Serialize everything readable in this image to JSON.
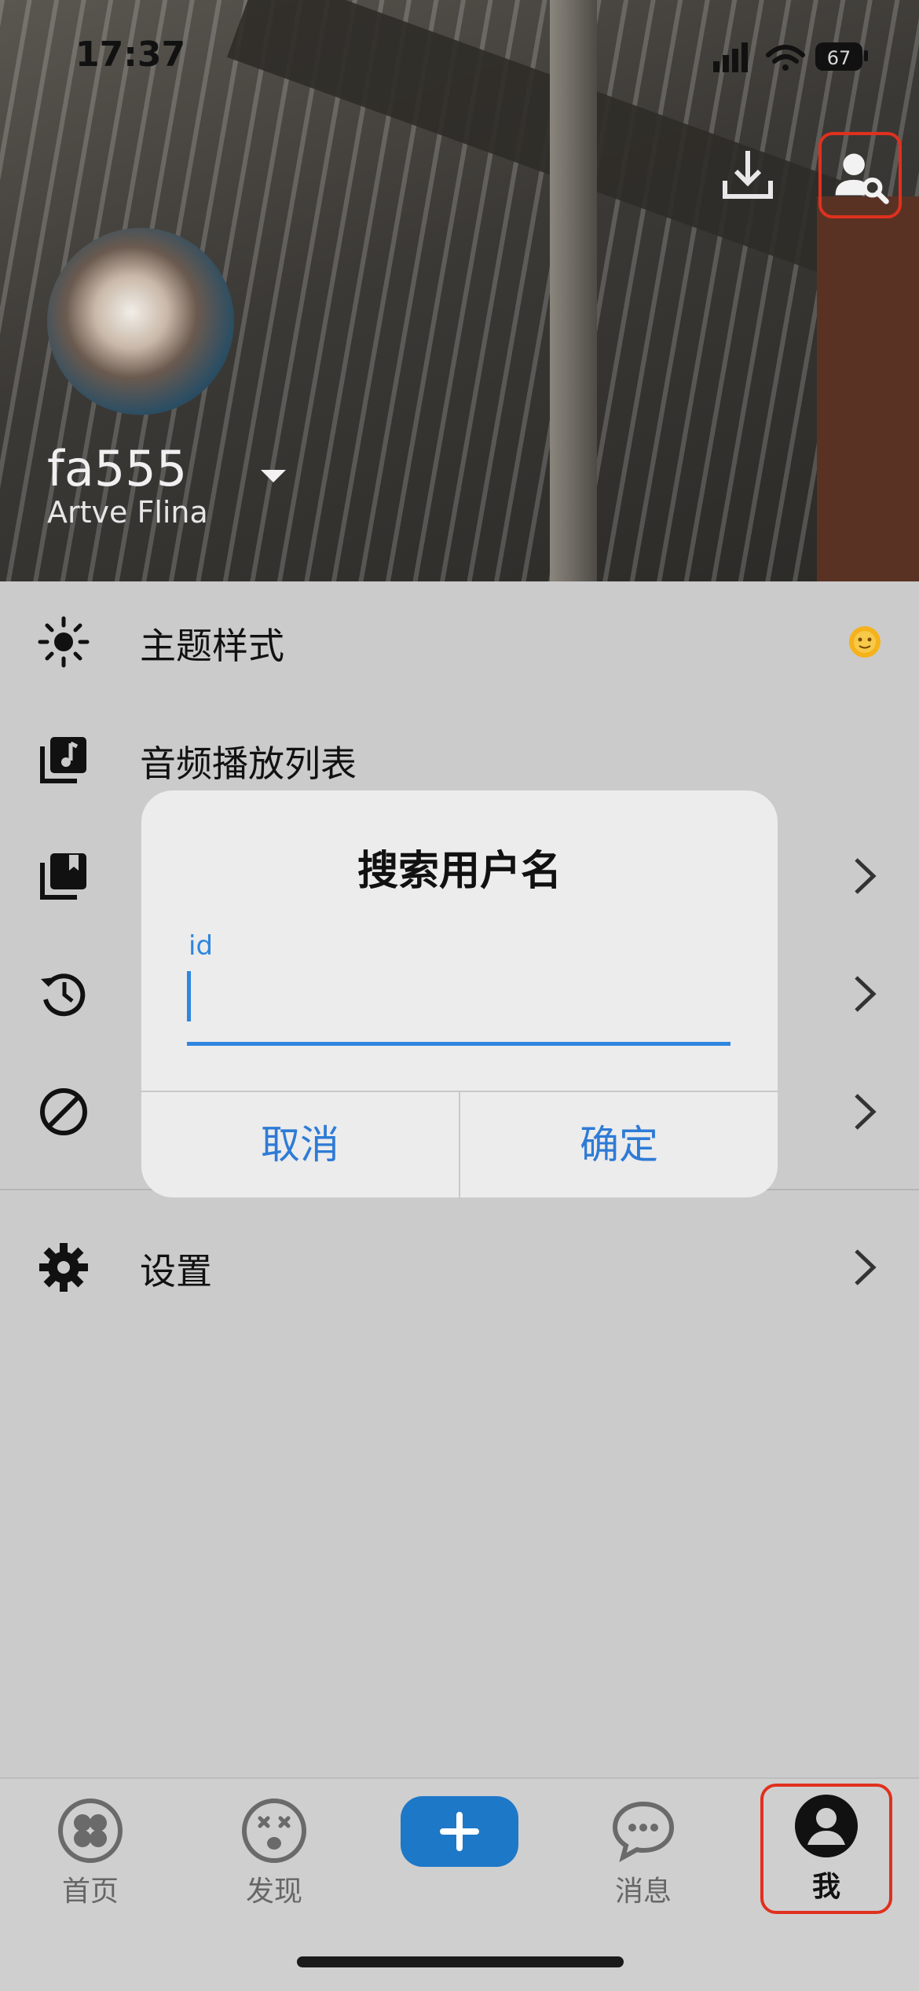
{
  "status_bar": {
    "time": "17:37",
    "battery": "67"
  },
  "profile": {
    "username": "fa555",
    "display_name": "Artve Flina"
  },
  "menu": {
    "items": [
      {
        "label": "主题样式",
        "icon": "sun-icon"
      },
      {
        "label": "音频播放列表",
        "icon": "music-playlist-icon"
      },
      {
        "label": "",
        "icon": "collections-icon"
      },
      {
        "label": "",
        "icon": "history-icon"
      },
      {
        "label": "",
        "icon": "block-icon"
      },
      {
        "label": "设置",
        "icon": "gear-icon"
      }
    ]
  },
  "dialog": {
    "title": "搜索用户名",
    "field_label": "id",
    "field_value": "",
    "cancel_label": "取消",
    "confirm_label": "确定"
  },
  "nav": {
    "tabs": [
      {
        "label": "首页",
        "icon": "home-clover-icon"
      },
      {
        "label": "发现",
        "icon": "discover-face-icon"
      },
      {
        "label": "",
        "icon": "plus-icon"
      },
      {
        "label": "消息",
        "icon": "chat-bubble-icon"
      },
      {
        "label": "我",
        "icon": "profile-icon"
      }
    ]
  },
  "colors": {
    "accent": "#2e86de",
    "highlight_border": "#e0301e",
    "background": "#cbcbcb"
  }
}
